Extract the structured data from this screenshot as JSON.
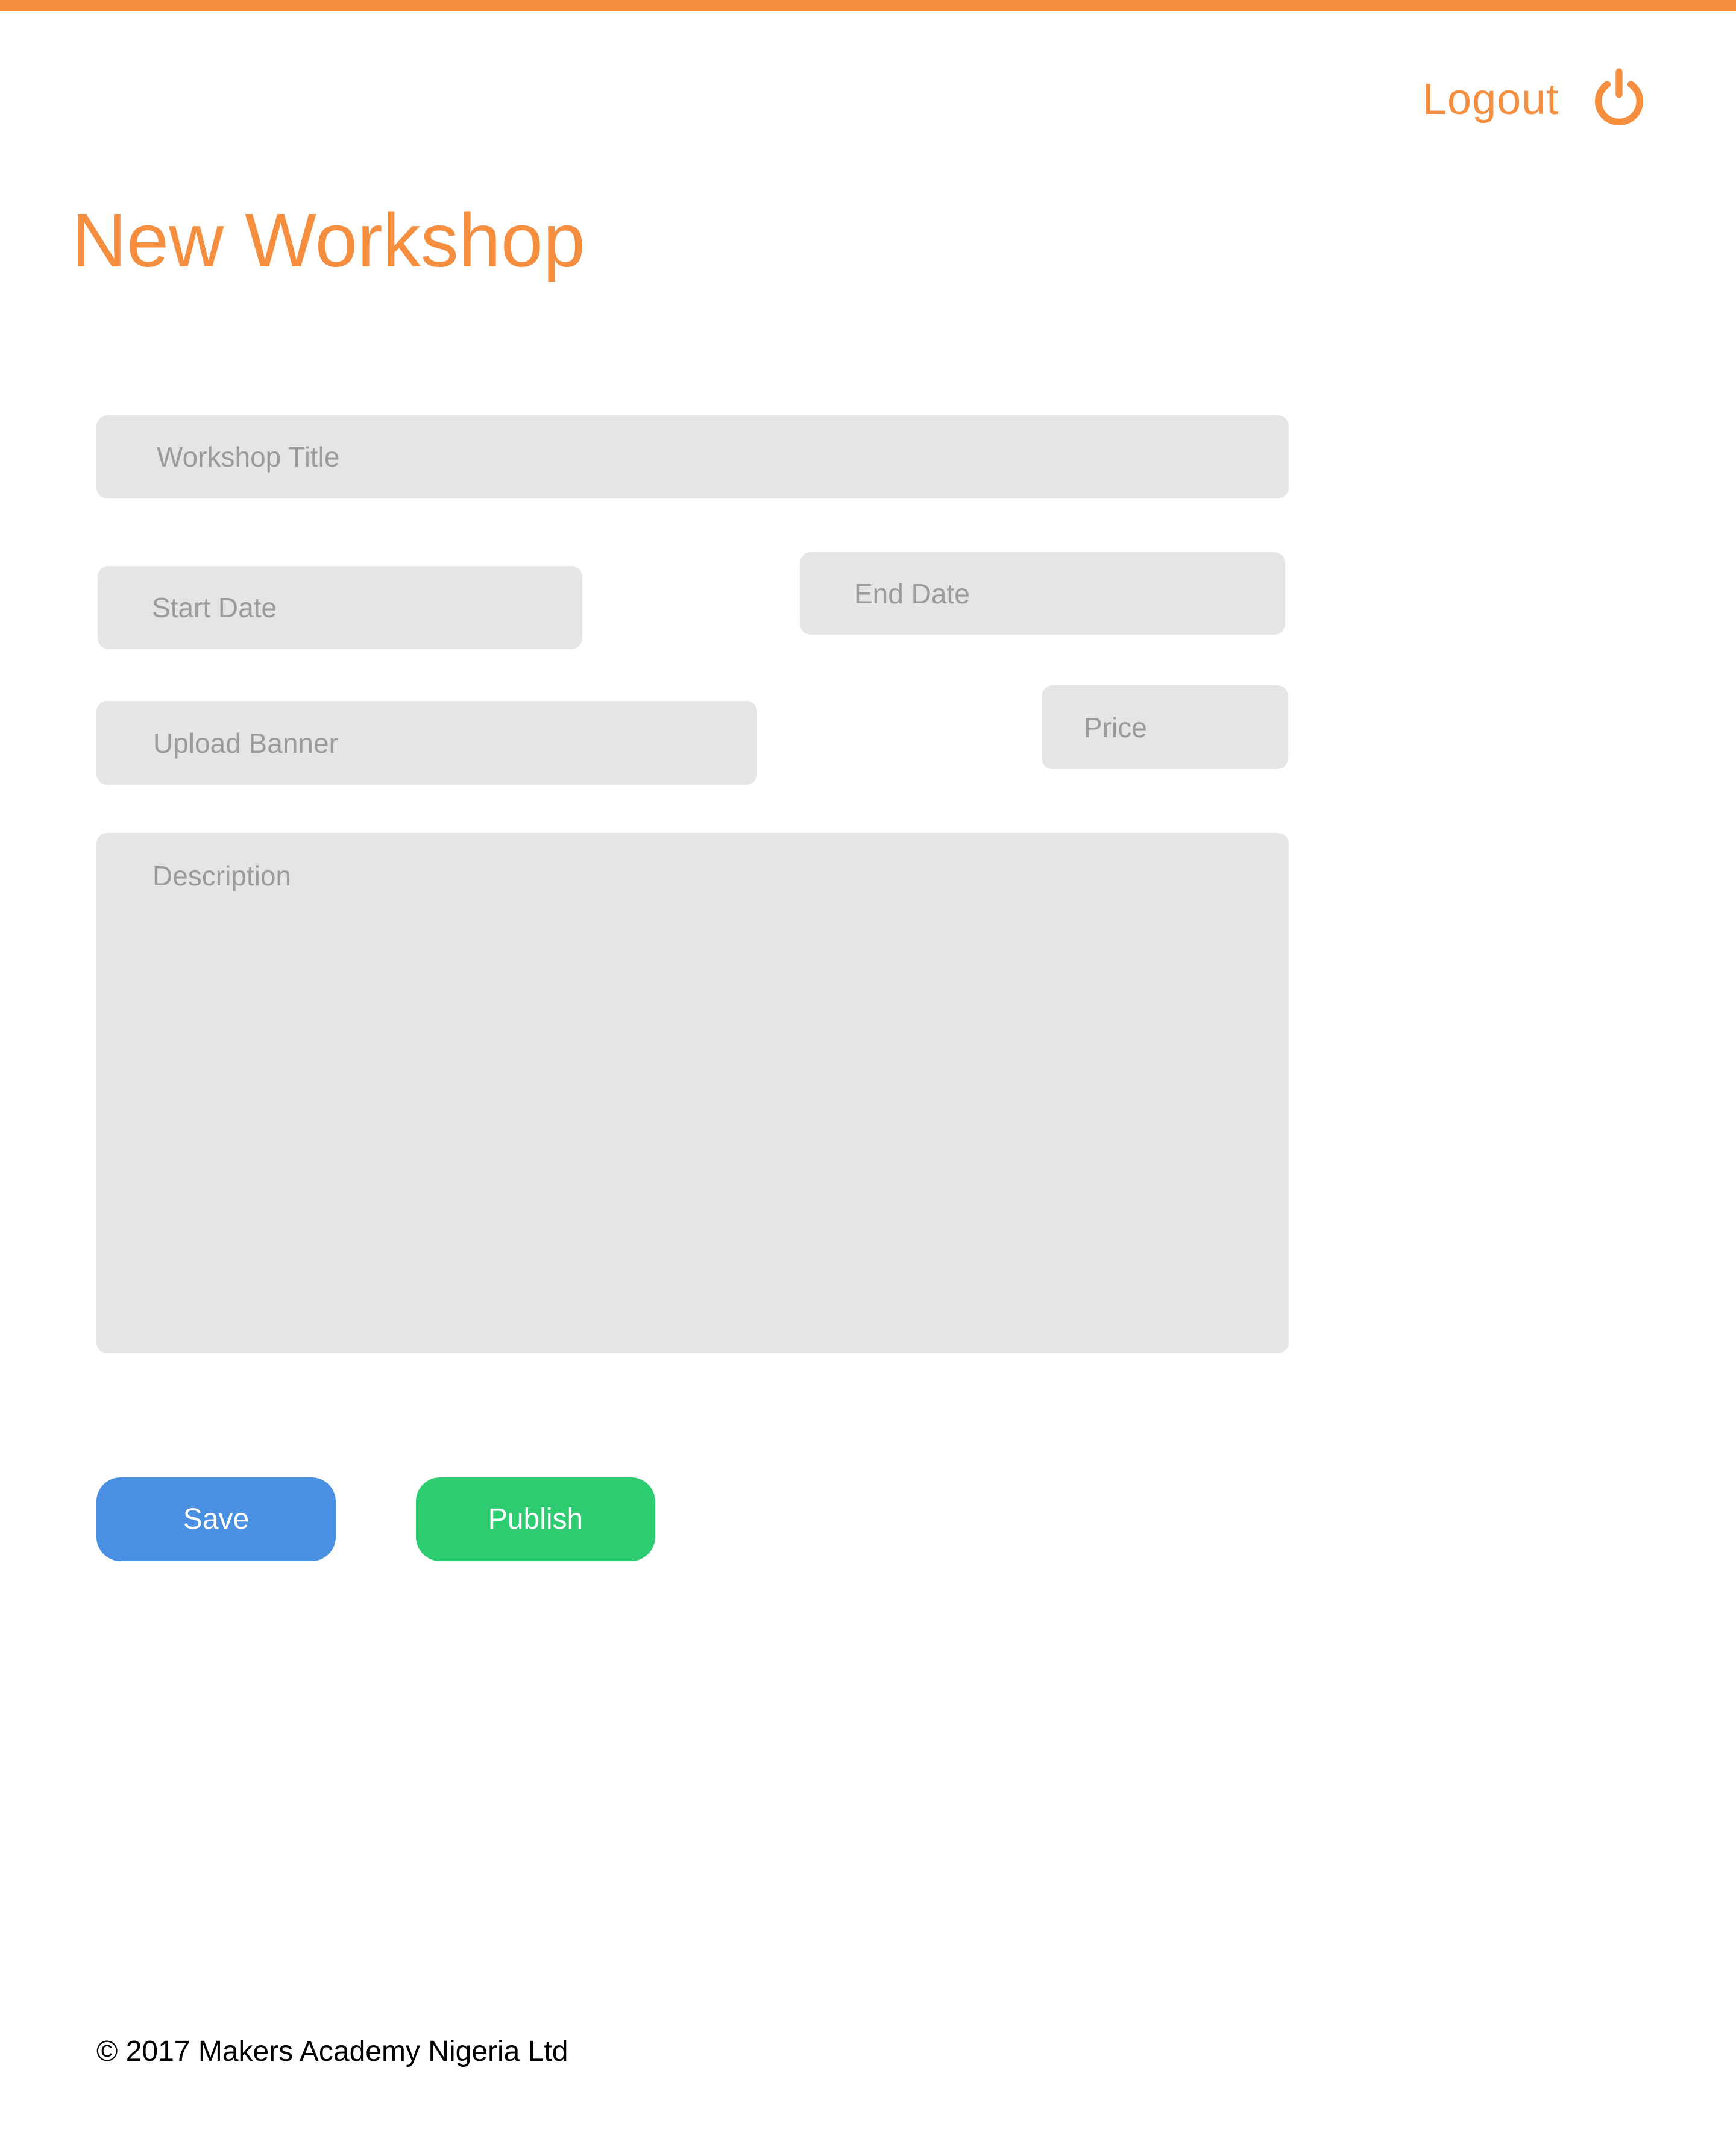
{
  "header": {
    "logout_label": "Logout",
    "logout_icon": "power-icon"
  },
  "page": {
    "title": "New Workshop"
  },
  "form": {
    "workshop_title": {
      "placeholder": "Workshop Title",
      "value": ""
    },
    "start_date": {
      "placeholder": "Start Date",
      "value": ""
    },
    "end_date": {
      "placeholder": "End Date",
      "value": ""
    },
    "upload_banner": {
      "placeholder": "Upload Banner",
      "value": ""
    },
    "price": {
      "placeholder": "Price",
      "value": ""
    },
    "description": {
      "placeholder": "Description",
      "value": ""
    }
  },
  "actions": {
    "save_label": "Save",
    "publish_label": "Publish"
  },
  "footer": {
    "copyright": "© 2017 Makers Academy Nigeria Ltd"
  },
  "colors": {
    "accent": "#F58E3E",
    "field_bg": "#E5E5E5",
    "placeholder": "#9B9B9B",
    "save": "#4A90E2",
    "publish": "#2ECC71"
  }
}
